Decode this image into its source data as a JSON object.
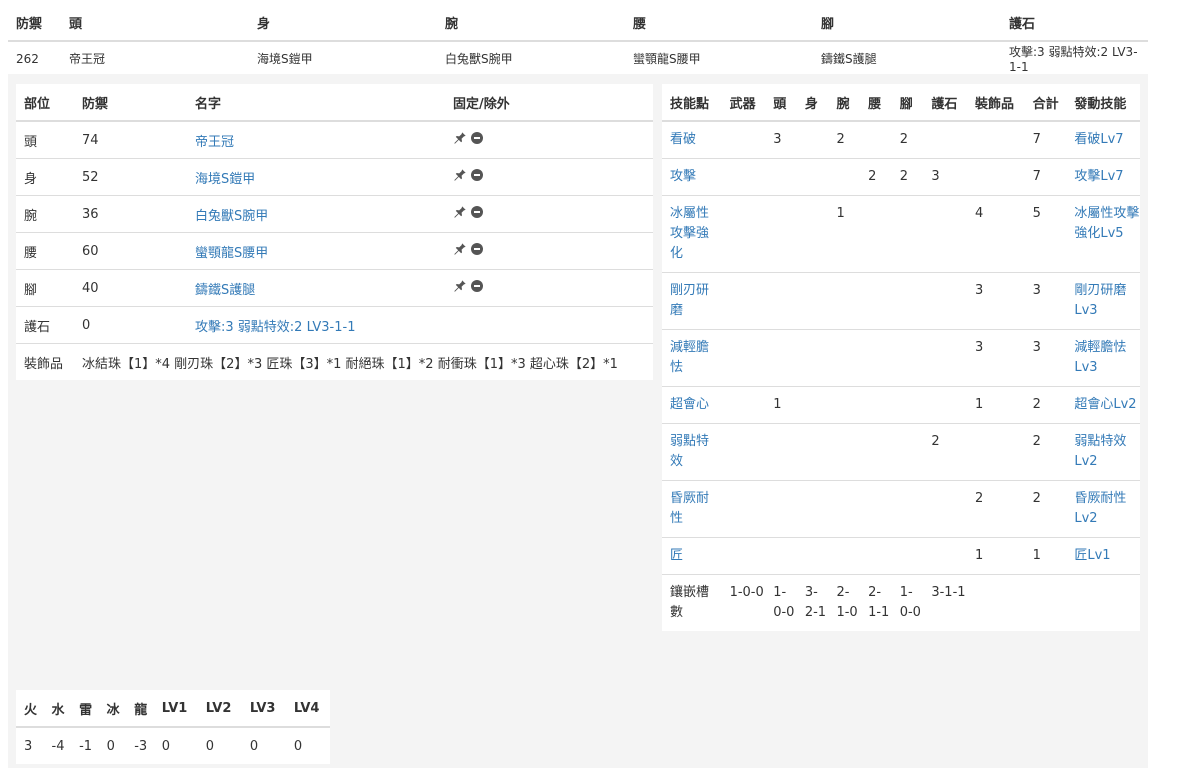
{
  "summary": {
    "headers": [
      "防禦",
      "頭",
      "身",
      "腕",
      "腰",
      "腳",
      "護石"
    ],
    "values": [
      "262",
      "帝王冠",
      "海境S鎧甲",
      "白兔獸S腕甲",
      "蠻顎龍S腰甲",
      "鑄鐵S護腿",
      "攻擊:3 弱點特效:2 LV3-1-1"
    ]
  },
  "equip": {
    "headers": [
      "部位",
      "防禦",
      "名字",
      "固定/除外"
    ],
    "rows": [
      {
        "part": "頭",
        "def": "74",
        "name": "帝王冠"
      },
      {
        "part": "身",
        "def": "52",
        "name": "海境S鎧甲"
      },
      {
        "part": "腕",
        "def": "36",
        "name": "白兔獸S腕甲"
      },
      {
        "part": "腰",
        "def": "60",
        "name": "蠻顎龍S腰甲"
      },
      {
        "part": "腳",
        "def": "40",
        "name": "鑄鐵S護腿"
      }
    ],
    "amulet": {
      "part": "護石",
      "def": "0",
      "name": "攻擊:3 弱點特效:2 LV3-1-1"
    },
    "decorations": {
      "label": "裝飾品",
      "value": "冰結珠【1】*4 剛刃珠【2】*3 匠珠【3】*1 耐絕珠【1】*2 耐衝珠【1】*3 超心珠【2】*1"
    }
  },
  "skills": {
    "headers": [
      "技能點",
      "武器",
      "頭",
      "身",
      "腕",
      "腰",
      "腳",
      "護石",
      "裝飾品",
      "合計",
      "發動技能"
    ],
    "rows": [
      {
        "name": "看破",
        "cols": [
          "",
          "3",
          "",
          "2",
          "",
          "2",
          "",
          "",
          "7"
        ],
        "active": "看破Lv7"
      },
      {
        "name": "攻擊",
        "cols": [
          "",
          "",
          "",
          "",
          "2",
          "2",
          "3",
          "",
          "7"
        ],
        "active": "攻擊Lv7"
      },
      {
        "name": "冰屬性攻擊強化",
        "cols": [
          "",
          "",
          "",
          "1",
          "",
          "",
          "",
          "4",
          "5"
        ],
        "active": "冰屬性攻擊強化Lv5"
      },
      {
        "name": "剛刃研磨",
        "cols": [
          "",
          "",
          "",
          "",
          "",
          "",
          "",
          "3",
          "3"
        ],
        "active": "剛刃研磨Lv3"
      },
      {
        "name": "減輕膽怯",
        "cols": [
          "",
          "",
          "",
          "",
          "",
          "",
          "",
          "3",
          "3"
        ],
        "active": "減輕膽怯Lv3"
      },
      {
        "name": "超會心",
        "cols": [
          "",
          "1",
          "",
          "",
          "",
          "",
          "",
          "1",
          "2"
        ],
        "active": "超會心Lv2"
      },
      {
        "name": "弱點特效",
        "cols": [
          "",
          "",
          "",
          "",
          "",
          "",
          "2",
          "",
          "2"
        ],
        "active": "弱點特效Lv2"
      },
      {
        "name": "昏厥耐性",
        "cols": [
          "",
          "",
          "",
          "",
          "",
          "",
          "",
          "2",
          "2"
        ],
        "active": "昏厥耐性Lv2"
      },
      {
        "name": "匠",
        "cols": [
          "",
          "",
          "",
          "",
          "",
          "",
          "",
          "1",
          "1"
        ],
        "active": "匠Lv1"
      }
    ],
    "slots": {
      "label": "鑲嵌槽數",
      "cols": [
        "1-0-0",
        "1-0-0",
        "3-2-1",
        "2-1-0",
        "2-1-1",
        "1-0-0",
        "3-1-1"
      ]
    }
  },
  "resist": {
    "headers": [
      "火",
      "水",
      "雷",
      "冰",
      "龍",
      "LV1",
      "LV2",
      "LV3",
      "LV4"
    ],
    "values": [
      "3",
      "-4",
      "-1",
      "0",
      "-3",
      "0",
      "0",
      "0",
      "0"
    ]
  },
  "icons": {
    "pin": "pin-icon",
    "remove": "minus-circle-icon"
  }
}
